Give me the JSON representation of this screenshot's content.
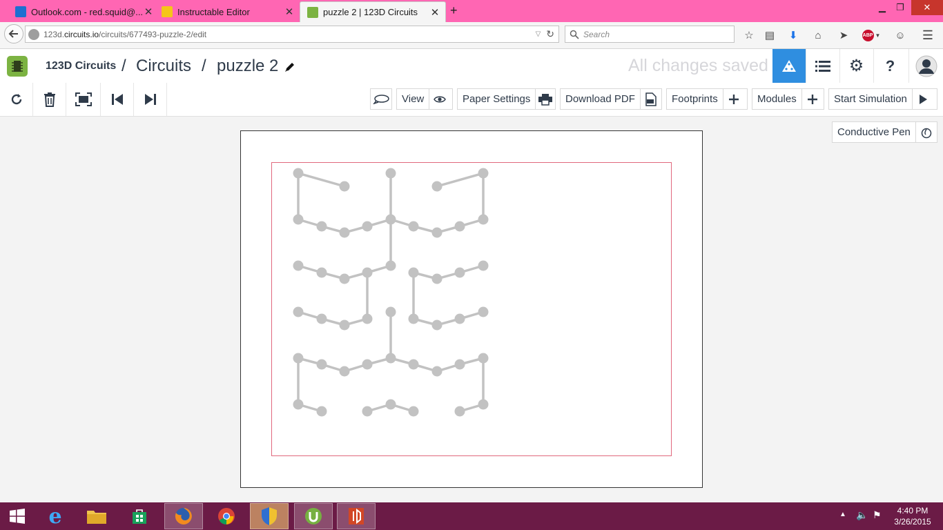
{
  "browser": {
    "tabs": [
      {
        "title": "Outlook.com - red.squid@...",
        "active": false,
        "icon_color": "#1e6fd1"
      },
      {
        "title": "Instructable Editor",
        "active": false,
        "icon_color": "#f5c518"
      },
      {
        "title": "puzzle 2 | 123D Circuits",
        "active": true,
        "icon_color": "#7cb342"
      }
    ],
    "url_prefix": "123d.",
    "url_domain": "circuits.io",
    "url_path": "/circuits/677493-puzzle-2/edit",
    "search_placeholder": "Search"
  },
  "app": {
    "brand": "123D Circuits",
    "sep1": "/",
    "section": "Circuits",
    "sep2": "/",
    "circuit_name": "puzzle 2",
    "save_status": "All changes saved",
    "help_label": "?",
    "accent_color": "#2f8ee0"
  },
  "toolbar": {
    "view_label": "View",
    "paper_settings_label": "Paper Settings",
    "download_pdf_label": "Download PDF",
    "footprints_label": "Footprints",
    "modules_label": "Modules",
    "start_simulation_label": "Start Simulation",
    "conductive_pen_label": "Conductive Pen"
  },
  "taskbar": {
    "time": "4:40 PM",
    "date": "3/26/2015"
  }
}
